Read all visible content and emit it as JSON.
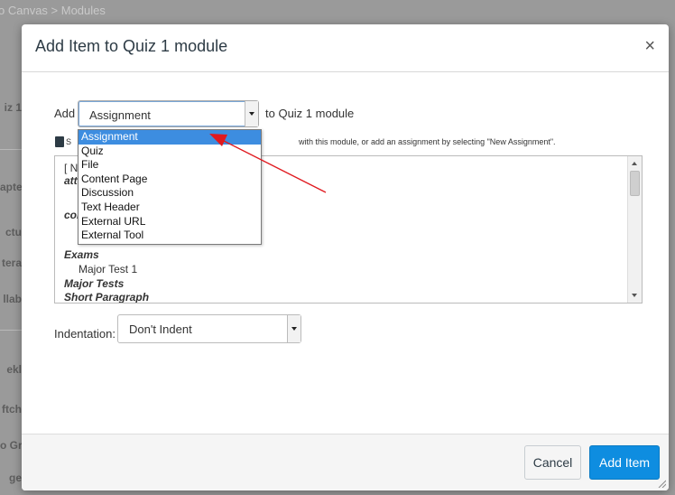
{
  "background": {
    "breadcrumb": "o Canvas > Modules",
    "left_fragments": [
      "iz 1",
      "apte",
      "ctu",
      "tera",
      "llab",
      "ekl",
      "ftch",
      "o Gr",
      "ge"
    ]
  },
  "modal": {
    "title": "Add Item to Quiz 1 module",
    "close_symbol": "×",
    "add_label": "Add",
    "item_type_select": {
      "value": "Assignment",
      "options": [
        "Assignment",
        "Quiz",
        "File",
        "Content Page",
        "Discussion",
        "Text Header",
        "External URL",
        "External Tool"
      ],
      "selected_index": 0
    },
    "to_label": "to Quiz 1 module",
    "hint_text_start": "S",
    "hint_text_end": "with this module, or add an assignment by selecting \"New Assignment\".",
    "assignment_list": [
      {
        "text": "[ N",
        "style": "plain"
      },
      {
        "text": "atti",
        "style": "group"
      },
      {
        "text": "cor",
        "style": "group"
      },
      {
        "text": "Exams",
        "style": "group"
      },
      {
        "text": "Major Test 1",
        "style": "item"
      },
      {
        "text": "Major Tests",
        "style": "group"
      },
      {
        "text": "Short Paragraph",
        "style": "group"
      }
    ],
    "indentation_label": "Indentation:",
    "indentation_select": {
      "value": "Don't Indent"
    },
    "footer": {
      "cancel_label": "Cancel",
      "add_item_label": "Add Item"
    }
  },
  "colors": {
    "accent": "#0e8de0",
    "selection": "#3d8de0",
    "annotation_arrow": "#e0191f"
  }
}
